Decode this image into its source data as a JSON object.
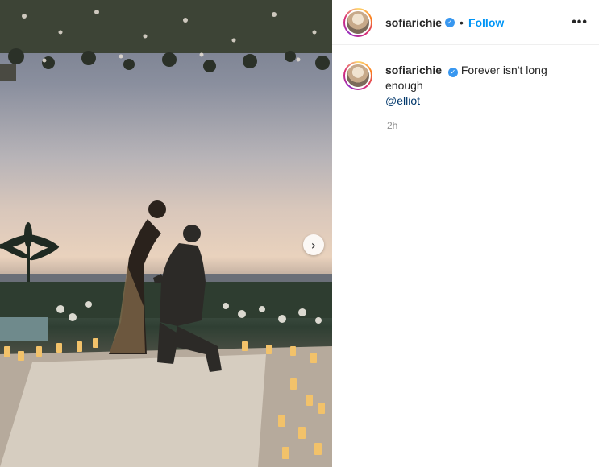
{
  "post": {
    "username": "sofiarichie",
    "follow_label": "Follow",
    "separator": "•",
    "more_label": "•••",
    "caption_text": "Forever isn't long enough",
    "caption_mention": "@elliot",
    "timestamp": "2h",
    "next_icon": "›",
    "verified_icon": "✓"
  },
  "colors": {
    "follow": "#0095f6",
    "verified": "#3897f0",
    "timestamp": "#8e8e8e",
    "mention": "#00376b"
  }
}
